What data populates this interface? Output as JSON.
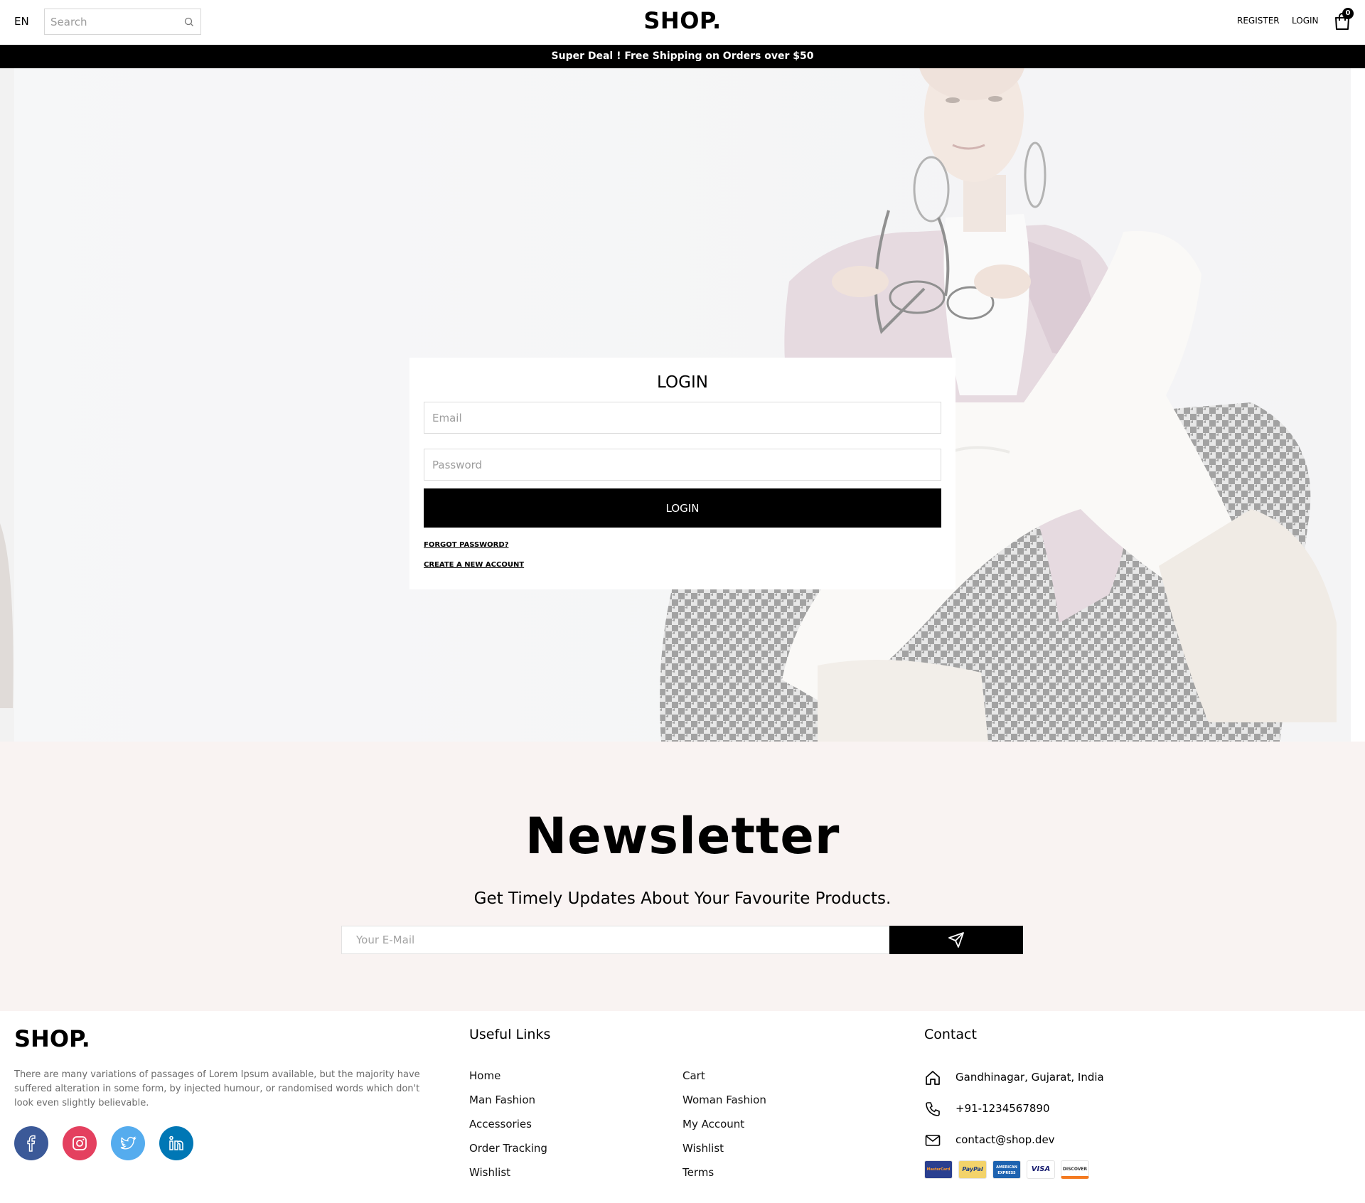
{
  "header": {
    "language": "EN",
    "search_placeholder": "Search",
    "logo": "SHOP.",
    "register": "REGISTER",
    "login": "LOGIN",
    "cart_count": "0"
  },
  "announcement": "Super Deal ! Free Shipping on Orders over $50",
  "login_form": {
    "title": "LOGIN",
    "email_placeholder": "Email",
    "password_placeholder": "Password",
    "submit": "LOGIN",
    "forgot": "FORGOT PASSWORD?",
    "create": "CREATE A NEW ACCOUNT"
  },
  "newsletter": {
    "title": "Newsletter",
    "subtitle": "Get Timely Updates About Your Favourite Products.",
    "email_placeholder": "Your E-Mail"
  },
  "footer": {
    "logo": "SHOP.",
    "description": "There are many variations of passages of Lorem Ipsum available, but the majority have suffered alteration in some form, by injected humour, or randomised words which don't look even slightly believable.",
    "social": [
      {
        "icon": "facebook-icon",
        "color": "#3b5998"
      },
      {
        "icon": "instagram-icon",
        "color": "#e4405f"
      },
      {
        "icon": "twitter-icon",
        "color": "#55acee"
      },
      {
        "icon": "linkedin-icon",
        "color": "#0077b5"
      }
    ],
    "useful_links_title": "Useful Links",
    "links_col1": [
      "Home",
      "Man Fashion",
      "Accessories",
      "Order Tracking",
      "Wishlist"
    ],
    "links_col2": [
      "Cart",
      "Woman Fashion",
      "My Account",
      "Wishlist",
      "Terms"
    ],
    "contact_title": "Contact",
    "address": "Gandhinagar, Gujarat, India",
    "phone": "+91-1234567890",
    "email": "contact@shop.dev",
    "payment_methods": [
      "MasterCard",
      "PayPal",
      "AMERICAN EXPRESS",
      "VISA",
      "DISCOVER"
    ]
  }
}
